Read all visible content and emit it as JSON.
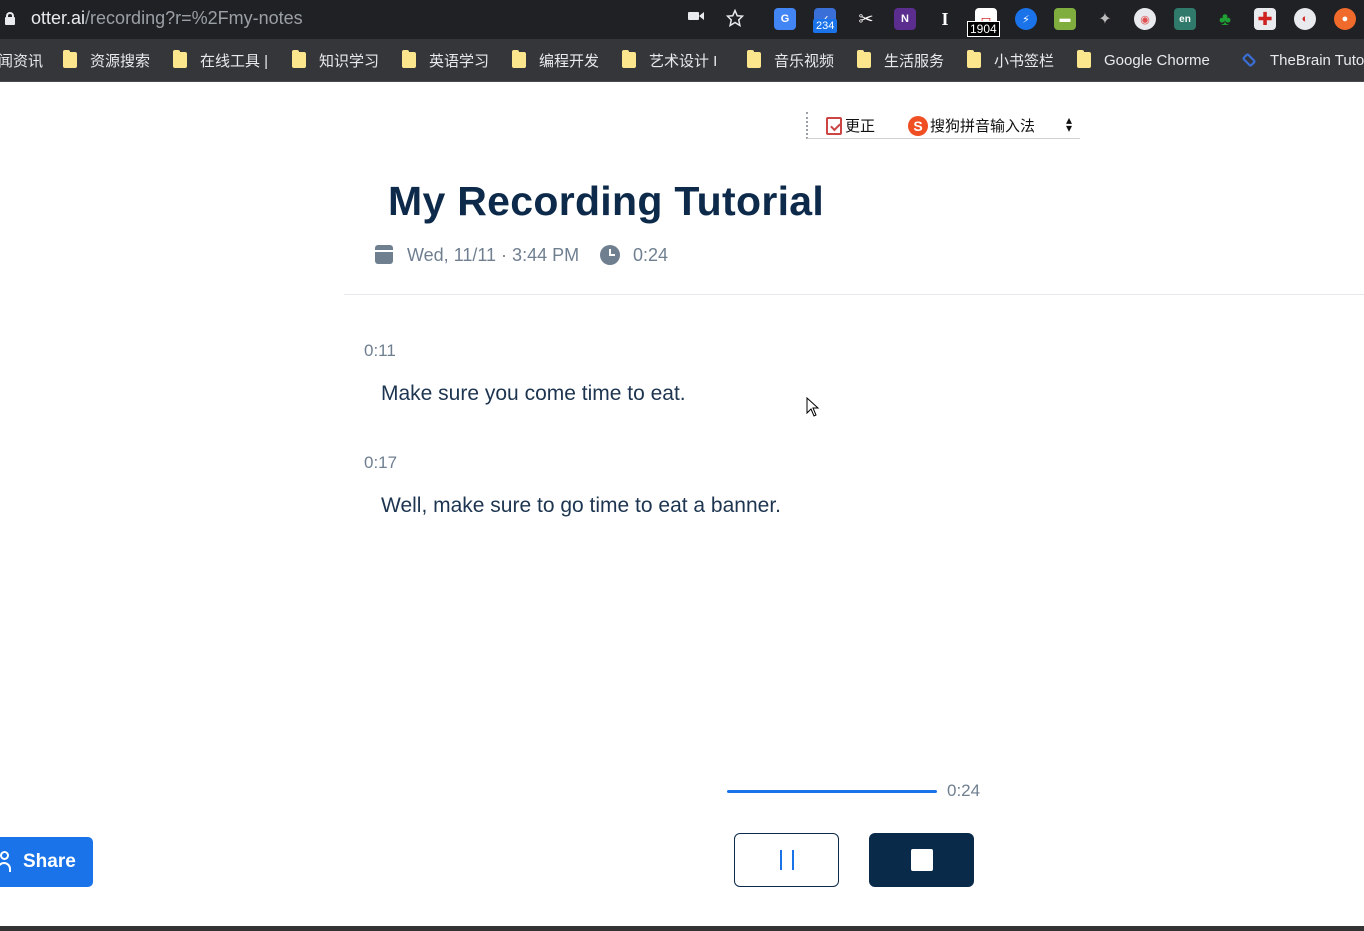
{
  "browser": {
    "url_host": "otter.ai",
    "url_path": "/recording?r=%2Fmy-notes",
    "extension_badges": [
      "234",
      "1904"
    ],
    "extension_icons": [
      "camera-icon",
      "star-icon",
      "google-translate-icon",
      "checker-icon",
      "scissors-icon",
      "onenote-icon",
      "text-cursor-icon",
      "calendar-extension-icon",
      "lightning-icon",
      "grass-icon",
      "pin-icon",
      "record-icon",
      "en-dictionary-icon",
      "evernote-icon",
      "medical-cross-icon",
      "chrome-color-icon",
      "orange-ball-icon"
    ]
  },
  "bookmarks": [
    {
      "label": "闻资讯"
    },
    {
      "label": "资源搜索"
    },
    {
      "label": "在线工具 |"
    },
    {
      "label": "知识学习"
    },
    {
      "label": "英语学习"
    },
    {
      "label": "编程开发"
    },
    {
      "label": "艺术设计 I"
    },
    {
      "label": "音乐视频"
    },
    {
      "label": "生活服务"
    },
    {
      "label": "小书签栏"
    },
    {
      "label": "Google Chorme"
    },
    {
      "label": "TheBrain Tuto"
    }
  ],
  "ime": {
    "correct_label": "更正",
    "sogou_label": "搜狗拼音输入法",
    "sogou_glyph": "S"
  },
  "recording": {
    "title": "My Recording Tutorial",
    "date": "Wed, 11/11 · 3:44 PM",
    "duration": "0:24"
  },
  "transcript": [
    {
      "timestamp": "0:11",
      "text": "Make sure you come time to eat."
    },
    {
      "timestamp": "0:17",
      "text": "Well, make sure to go time to eat a banner."
    }
  ],
  "player": {
    "elapsed": "0:24",
    "progress": 1.0
  },
  "share_label": "Share",
  "colors": {
    "title": "#0d2a4a",
    "accent": "#1a73e8",
    "stop_button": "#0a2a4a",
    "meta_text": "#6f7f90"
  }
}
